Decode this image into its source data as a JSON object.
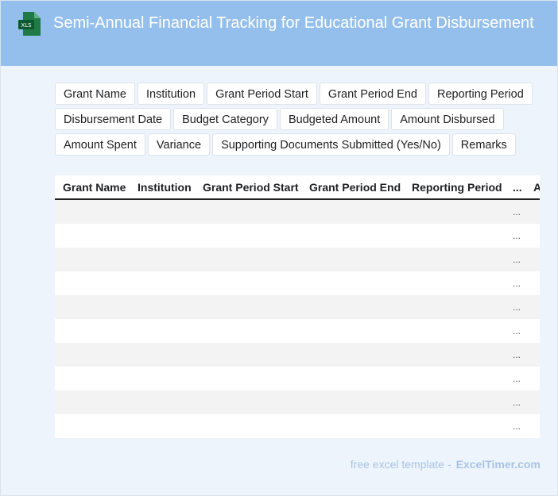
{
  "header": {
    "icon": "xls-file-icon",
    "icon_label": "XLS",
    "title": "Semi-Annual Financial Tracking for Educational Grant Disbursement",
    "color": "#94bfec"
  },
  "columns": [
    "Grant Name",
    "Institution",
    "Grant Period Start",
    "Grant Period End",
    "Reporting Period",
    "Disbursement Date",
    "Budget Category",
    "Budgeted Amount",
    "Amount Disbursed",
    "Amount Spent",
    "Variance",
    "Supporting Documents Submitted (Yes/No)",
    "Remarks"
  ],
  "table": {
    "headers": [
      "Grant Name",
      "Institution",
      "Grant Period Start",
      "Grant Period End",
      "Reporting Period",
      "...",
      "A"
    ],
    "rows": [
      [
        "",
        "",
        "",
        "",
        "",
        "...",
        ""
      ],
      [
        "",
        "",
        "",
        "",
        "",
        "...",
        ""
      ],
      [
        "",
        "",
        "",
        "",
        "",
        "...",
        ""
      ],
      [
        "",
        "",
        "",
        "",
        "",
        "...",
        ""
      ],
      [
        "",
        "",
        "",
        "",
        "",
        "...",
        ""
      ],
      [
        "",
        "",
        "",
        "",
        "",
        "...",
        ""
      ],
      [
        "",
        "",
        "",
        "",
        "",
        "...",
        ""
      ],
      [
        "",
        "",
        "",
        "",
        "",
        "...",
        ""
      ],
      [
        "",
        "",
        "",
        "",
        "",
        "...",
        ""
      ],
      [
        "",
        "",
        "",
        "",
        "",
        "...",
        ""
      ]
    ]
  },
  "footer": {
    "text": "free excel template -",
    "brand": "ExcelTimer.com"
  }
}
